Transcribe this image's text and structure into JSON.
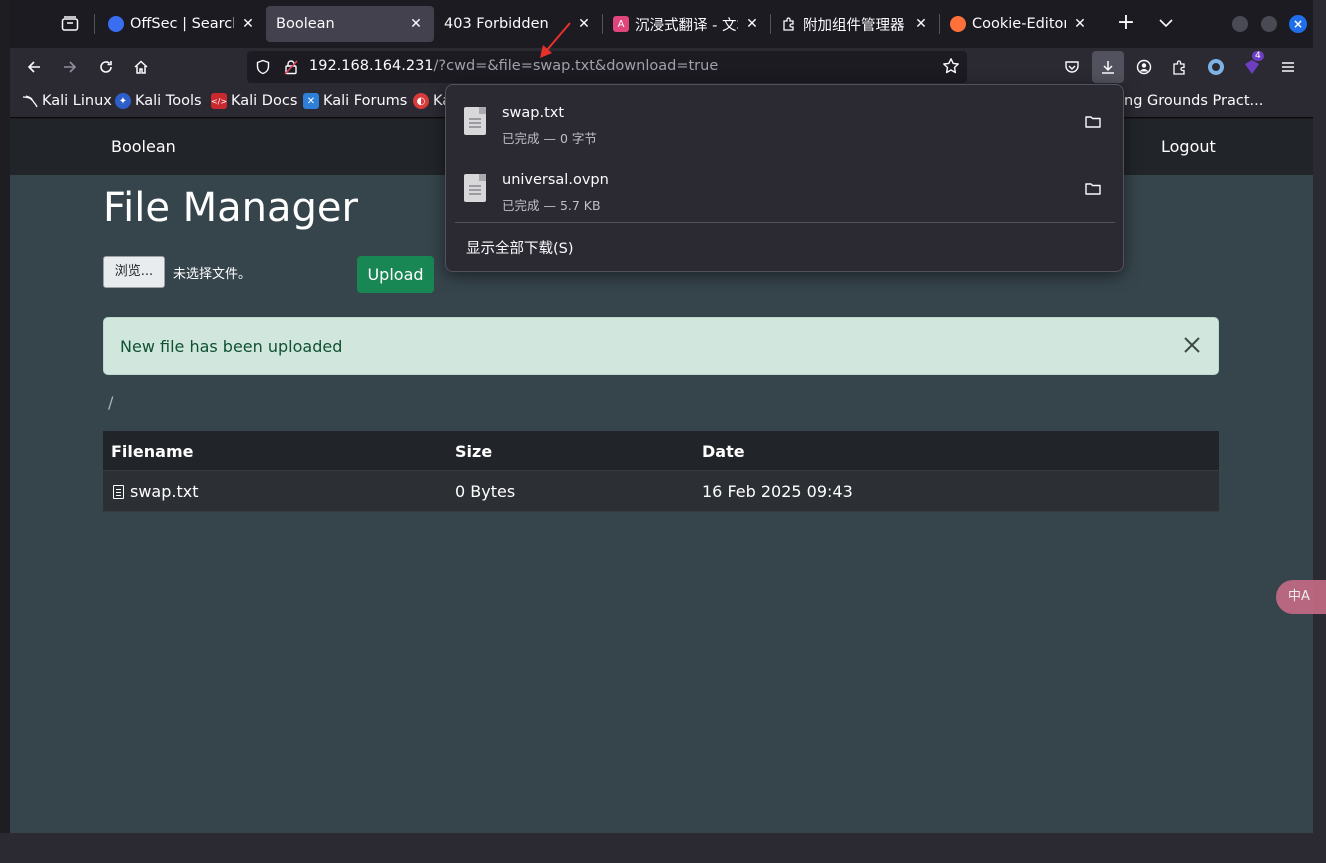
{
  "tabs": [
    {
      "title": "OffSec | Search",
      "favicon_color": "#3a6df0",
      "active": false
    },
    {
      "title": "Boolean",
      "active": true
    },
    {
      "title": "403 Forbidden",
      "active": false
    },
    {
      "title": "沉浸式翻译 - 文本",
      "favicon_color": "#e0457b",
      "active": false
    },
    {
      "title": "附加组件管理器",
      "active": false
    },
    {
      "title": "Cookie-Editor – Ti",
      "favicon_color": "#ff7139",
      "active": false
    }
  ],
  "tab_close_glyph": "✕",
  "urlbar": {
    "host": "192.168.164.231",
    "path": "/?cwd=&file=swap.txt&download=true"
  },
  "extension_badge": "4",
  "bookmarks": [
    {
      "label": "Kali Linux"
    },
    {
      "label": "Kali Tools"
    },
    {
      "label": "Kali Docs"
    },
    {
      "label": "Kali Forums"
    },
    {
      "label": "Ka"
    },
    {
      "label": "ing Grounds Pract..."
    }
  ],
  "site": {
    "brand": "Boolean",
    "logout": "Logout",
    "heading": "File Manager",
    "browse_label": "浏览...",
    "no_file_label": "未选择文件。",
    "upload_label": "Upload",
    "alert_text": "New file has been uploaded",
    "current_path": "/"
  },
  "table": {
    "headers": [
      "Filename",
      "Size",
      "Date"
    ],
    "rows": [
      {
        "filename": "swap.txt",
        "size": "0 Bytes",
        "date": "16 Feb 2025 09:43"
      }
    ]
  },
  "downloads": {
    "items": [
      {
        "name": "swap.txt",
        "status": "已完成 — 0 字节"
      },
      {
        "name": "universal.ovpn",
        "status": "已完成 — 5.7 KB"
      }
    ],
    "show_all": "显示全部下载(S)"
  },
  "translate_fab": "中A",
  "colors": {
    "accent": "#1f6feb",
    "success": "#198754",
    "alert_bg": "#d1e7dd",
    "page_bg": "#36454c",
    "annotation_arrow": "#e8312b"
  },
  "icons": [
    "tab-list-icon",
    "back-icon",
    "forward-icon",
    "reload-icon",
    "home-icon",
    "shield-icon",
    "lock-warning-icon",
    "star-icon",
    "pocket-icon",
    "download-icon",
    "account-icon",
    "extensions-icon",
    "menu-icon",
    "folder-icon",
    "file-icon",
    "close-icon"
  ]
}
